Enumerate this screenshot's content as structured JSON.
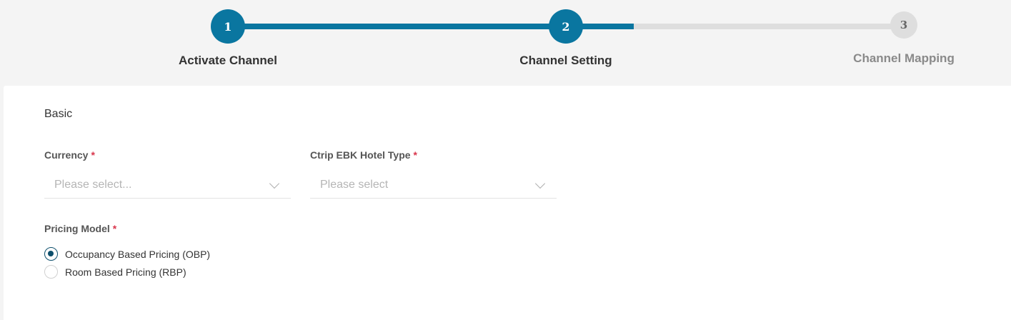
{
  "stepper": {
    "steps": [
      {
        "number": "1",
        "label": "Activate Channel",
        "state": "completed"
      },
      {
        "number": "2",
        "label": "Channel Setting",
        "state": "active"
      },
      {
        "number": "3",
        "label": "Channel Mapping",
        "state": "pending"
      }
    ],
    "progress_color": "#0a76a0",
    "pending_color": "#dedede"
  },
  "form": {
    "section_title": "Basic",
    "currency": {
      "label": "Currency",
      "required_mark": "*",
      "placeholder": "Please select..."
    },
    "hotel_type": {
      "label": "Ctrip EBK Hotel Type",
      "required_mark": "*",
      "placeholder": "Please select"
    },
    "pricing_model": {
      "label": "Pricing Model",
      "required_mark": "*",
      "options": [
        {
          "label": "Occupancy Based Pricing (OBP)",
          "selected": true
        },
        {
          "label": "Room Based Pricing (RBP)",
          "selected": false
        }
      ]
    }
  },
  "colors": {
    "accent": "#0a76a0",
    "required": "#d9364c",
    "radio_selected": "#0d4f6c"
  }
}
